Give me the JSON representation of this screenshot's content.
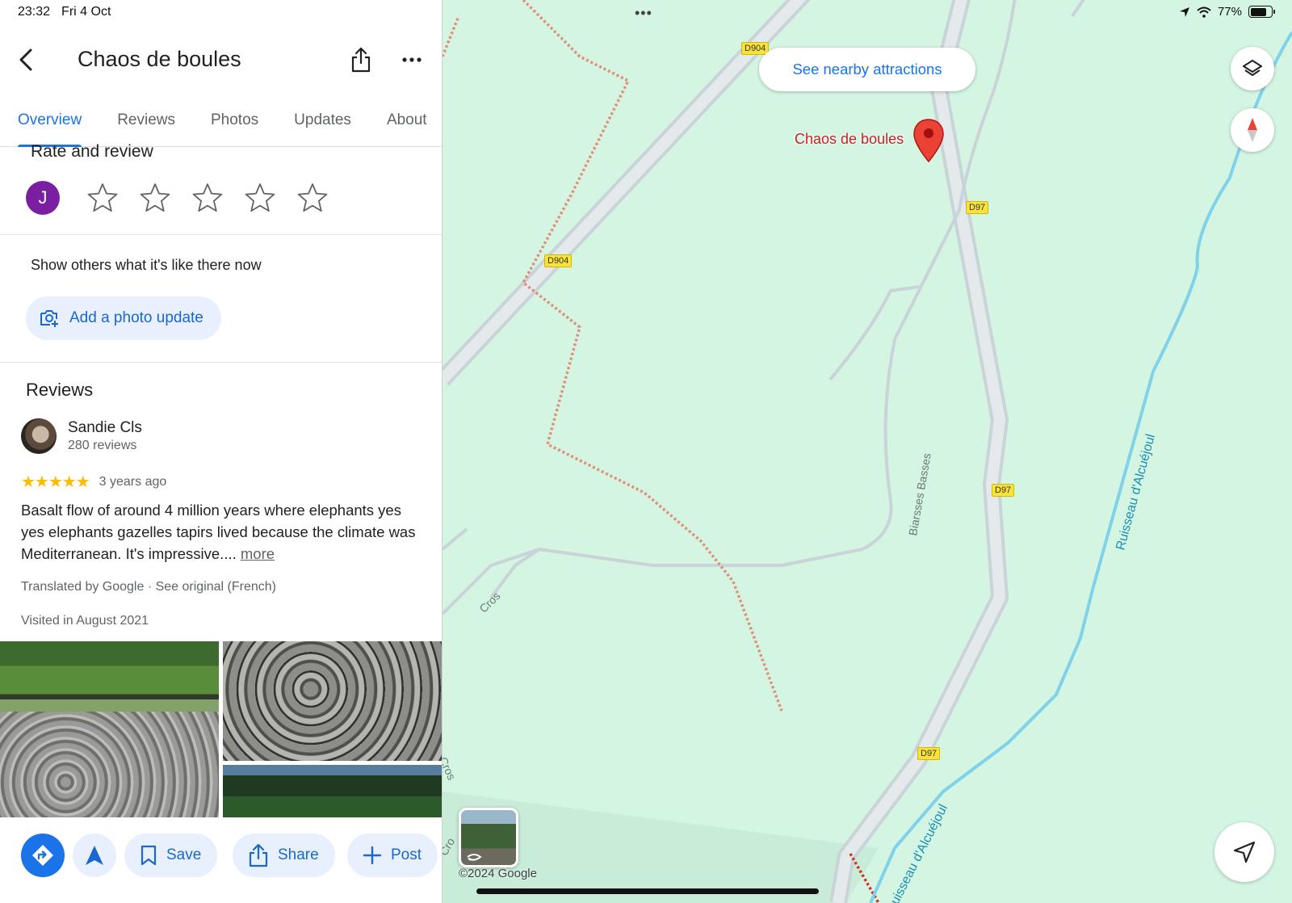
{
  "status_bar": {
    "time": "23:32",
    "date": "Fri 4 Oct",
    "battery": "77%",
    "battery_level": 0.77
  },
  "place": {
    "title": "Chaos de boules",
    "tabs": [
      {
        "label": "Overview",
        "active": true
      },
      {
        "label": "Reviews"
      },
      {
        "label": "Photos"
      },
      {
        "label": "Updates"
      },
      {
        "label": "About"
      }
    ]
  },
  "rate": {
    "title": "Rate and review",
    "user_initial": "J",
    "star_count": 5
  },
  "photo_update": {
    "prompt": "Show others what it's like there now",
    "button_label": "Add a photo update"
  },
  "reviews": {
    "title": "Reviews",
    "items": [
      {
        "name": "Sandie Cls",
        "count": "280 reviews",
        "rating": 5,
        "stars": "★★★★★",
        "time": "3 years ago",
        "text": "Basalt flow of around 4 million years where elephants yes yes elephants gazelles tapirs lived because the climate was Mediterranean.  It's impressive....",
        "more": "more",
        "translated": "Translated by Google · ",
        "see_original": "See original (French)",
        "visited": "Visited in August 2021"
      }
    ]
  },
  "actions": {
    "save": "Save",
    "share": "Share",
    "post": "Post"
  },
  "map": {
    "nearby_button": "See nearby attractions",
    "pin_label": "Chaos de boules",
    "road_labels": {
      "d904_top": "D904",
      "d904_mid": "D904",
      "d97_a": "D97",
      "d97_b": "D97",
      "d97_c": "D97"
    },
    "streets": {
      "biarsses": "Biarsses Basses",
      "cros_1": "Cros",
      "cros_2": "Cros",
      "cros_3": "Cro"
    },
    "waterways": {
      "upper": "Ruisseau d'Alcuéjoul",
      "lower": "uisseau d'Alcuéjoul"
    },
    "copyright": "©2024 Google",
    "colors": {
      "land": "#d3f5e2",
      "road": "#c9d3d8",
      "water": "#7fd2ea",
      "trail": "#e0907a",
      "accent": "#1a73e8",
      "pin": "#ea4335"
    }
  }
}
